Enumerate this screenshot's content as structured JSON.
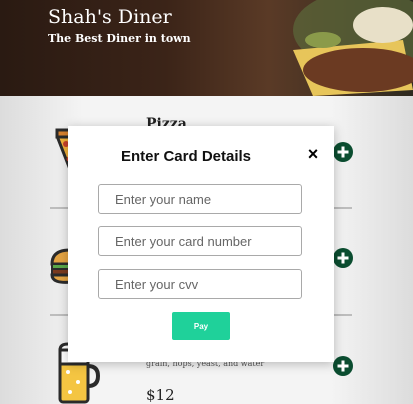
{
  "header": {
    "title": "Shah's Diner",
    "tagline": "The Best Diner in town"
  },
  "menu": {
    "items": [
      {
        "name": "Pizza",
        "icon": "pizza-icon"
      },
      {
        "name": "",
        "icon": "burger-icon"
      },
      {
        "name": "",
        "icon": "beer-icon",
        "description": "grain, hops, yeast, and water",
        "price": "$12"
      }
    ]
  },
  "modal": {
    "title": "Enter Card Details",
    "close_label": "×",
    "name_placeholder": "Enter your name",
    "card_placeholder": "Enter your card number",
    "cvv_placeholder": "Enter your cvv",
    "pay_label": "Pay"
  },
  "colors": {
    "add_button": "#0b4d30",
    "pay_button": "#1fd19a"
  }
}
